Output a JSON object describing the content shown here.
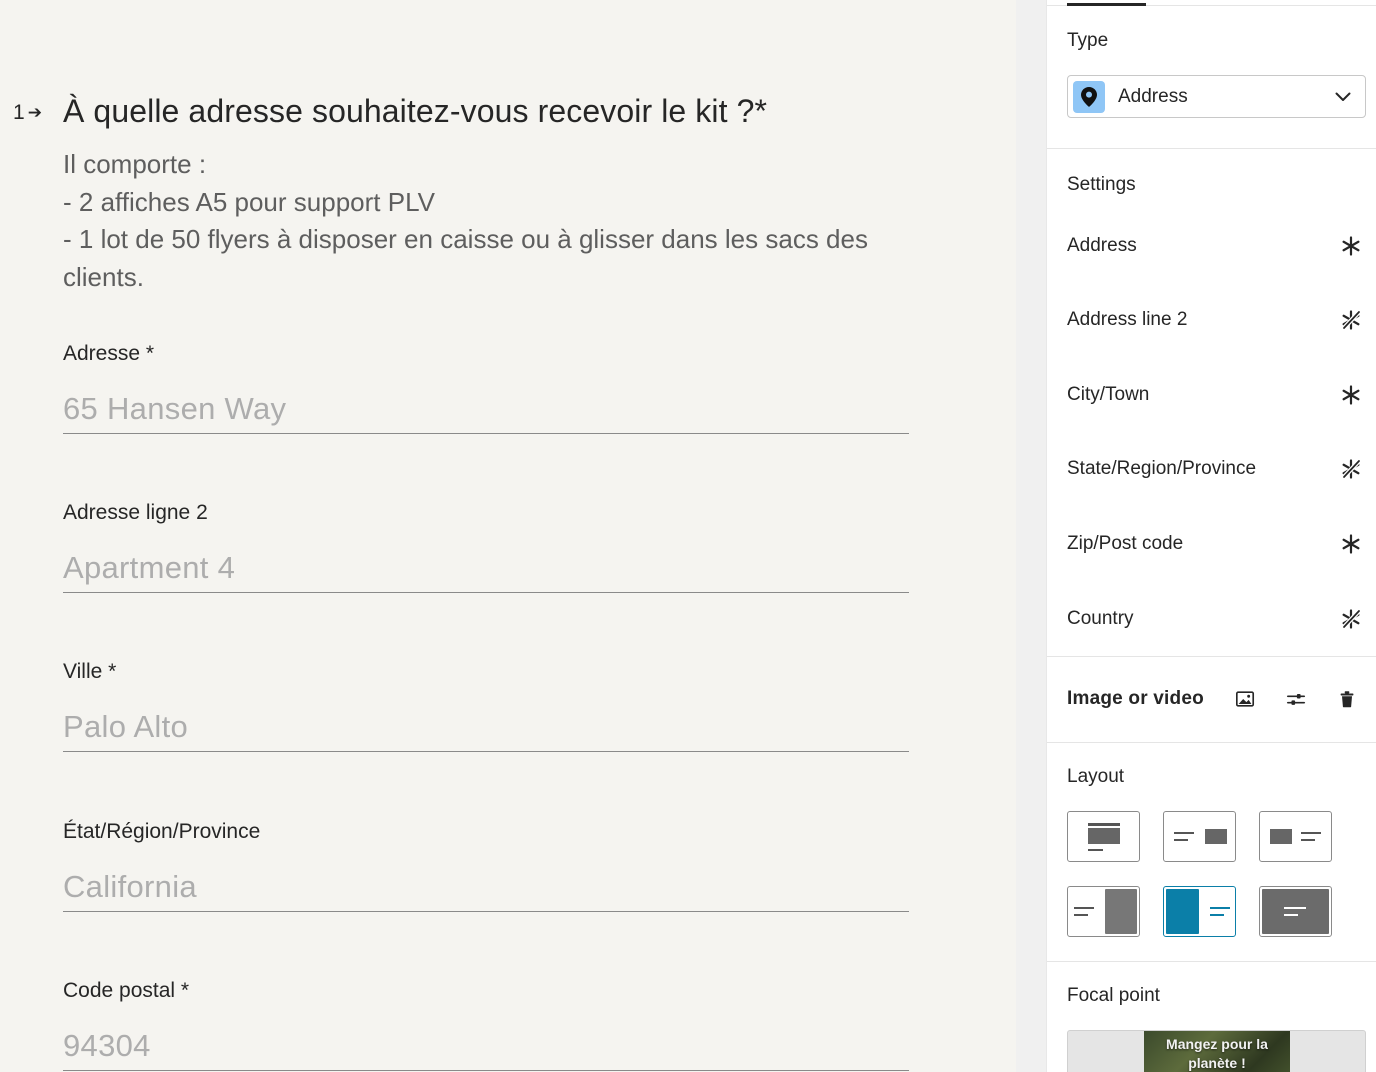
{
  "question": {
    "number": "1",
    "title": "À quelle adresse souhaitez-vous recevoir le kit ?*",
    "description_lines": [
      "Il comporte :",
      "- 2 affiches A5 pour support PLV",
      "- 1 lot de 50 flyers à disposer en caisse ou à glisser dans les sacs des",
      "clients."
    ]
  },
  "fields": [
    {
      "label": "Adresse *",
      "placeholder": "65 Hansen Way"
    },
    {
      "label": "Adresse ligne 2",
      "placeholder": "Apartment 4"
    },
    {
      "label": "Ville *",
      "placeholder": "Palo Alto"
    },
    {
      "label": "État/Région/Province",
      "placeholder": "California"
    },
    {
      "label": "Code postal *",
      "placeholder": "94304"
    }
  ],
  "panel": {
    "type": {
      "title": "Type",
      "selected": "Address",
      "icon": "location-pin-icon",
      "icon_bg": "#8fc6f6"
    },
    "settings": {
      "title": "Settings",
      "items": [
        {
          "label": "Address",
          "required": true
        },
        {
          "label": "Address line 2",
          "required": false
        },
        {
          "label": "City/Town",
          "required": true
        },
        {
          "label": "State/Region/Province",
          "required": false
        },
        {
          "label": "Zip/Post code",
          "required": true
        },
        {
          "label": "Country",
          "required": false
        }
      ]
    },
    "media": {
      "title": "Image or video",
      "icons": [
        "image-icon",
        "sliders-icon",
        "trash-icon"
      ]
    },
    "layout": {
      "title": "Layout",
      "options": [
        "stack",
        "split-left-text",
        "split-right-text",
        "float-right-media",
        "float-left-media",
        "wallpaper"
      ],
      "selected_index": 4,
      "accent": "#0b7fa8"
    },
    "focal": {
      "title": "Focal point",
      "thumb_text": "Mangez pour la planète !"
    }
  }
}
